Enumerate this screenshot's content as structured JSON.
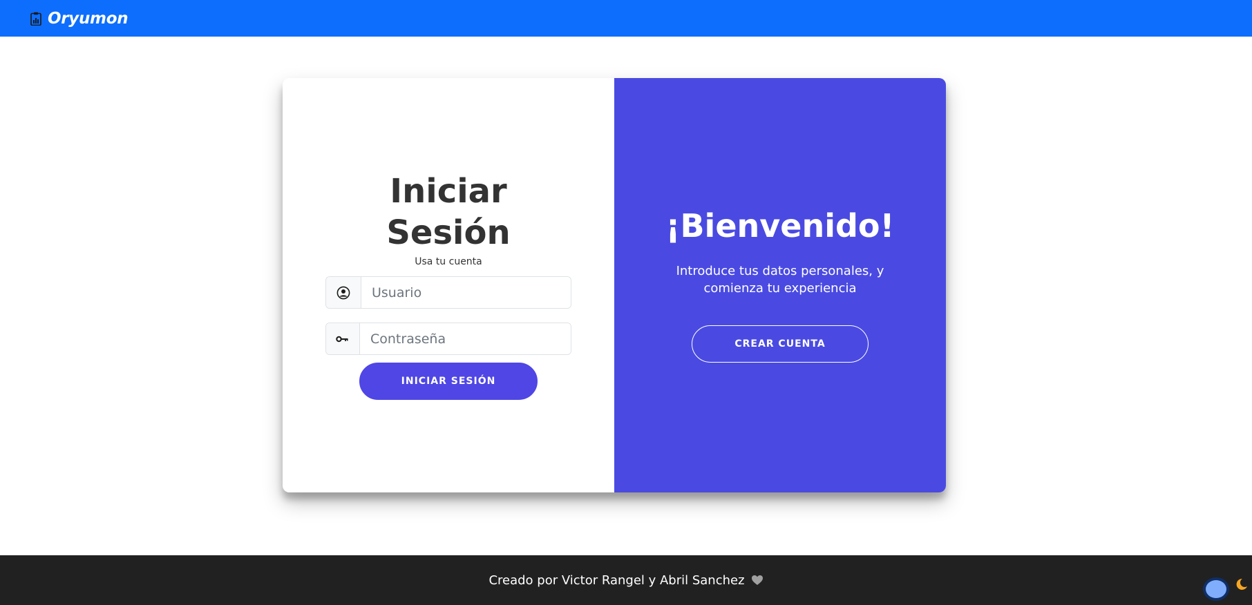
{
  "navbar": {
    "brand": "Oryumon",
    "brand_icon": "clipboard-chart-icon",
    "color": "#0d6efd"
  },
  "login": {
    "title": "Iniciar Sesión",
    "subtitle": "Usa tu cuenta",
    "username": {
      "placeholder": "Usuario",
      "value": "",
      "icon": "user-circle-icon"
    },
    "password": {
      "placeholder": "Contraseña",
      "value": "",
      "icon": "key-icon"
    },
    "submit_label": "INICIAR SESIÓN",
    "button_color": "#4f46e5"
  },
  "welcome_panel": {
    "title": "¡Bienvenido!",
    "message": "Introduce tus datos personales, y comienza tu experiencia",
    "create_label": "CREAR CUENTA",
    "background": "#4a4ae2"
  },
  "footer": {
    "text": "Creado por Victor Rangel y Abril Sanchez",
    "heart_icon": "heart-icon",
    "background": "#212121"
  },
  "theme_toggle": {
    "state": "dark-mode-off",
    "icon": "moon-icon",
    "moon_color": "#f5a623"
  }
}
